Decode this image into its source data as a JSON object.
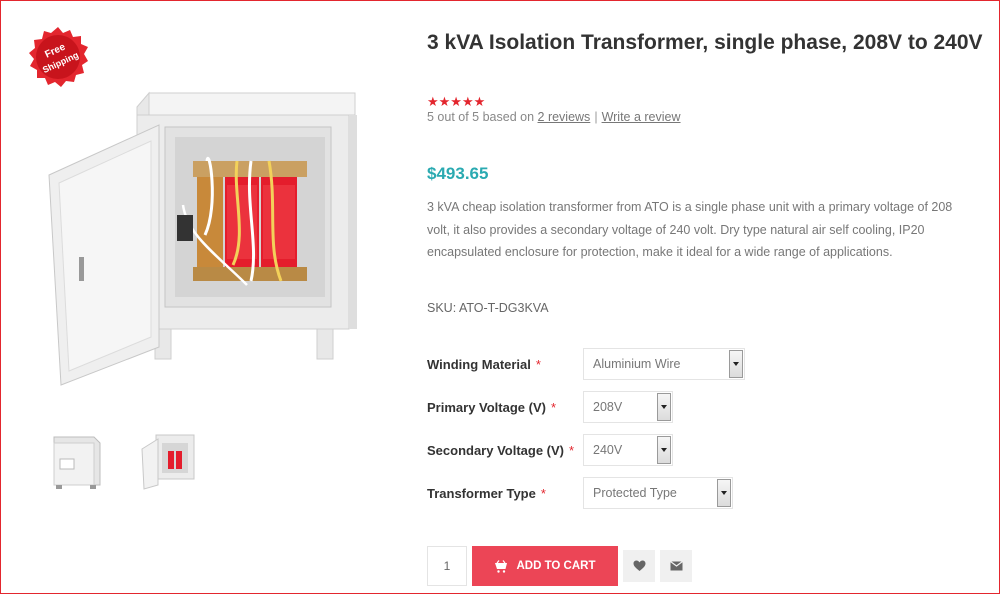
{
  "badge": {
    "line1": "Free",
    "line2": "Shipping"
  },
  "product": {
    "title": "3 kVA Isolation Transformer, single phase, 208V to 240V",
    "stars": "★★★★★",
    "rating_value": 5,
    "rating_prefix": "5 out of 5 based on",
    "reviews_link": "2 reviews",
    "separator": "|",
    "write_review": "Write a review",
    "price": "$493.65",
    "description_lines": [
      "3 kVA cheap isolation transformer from ATO is a single phase unit with a primary voltage of 208",
      "volt, it also provides a secondary voltage of 240 volt. Dry type natural air self cooling, IP20",
      "encapsulated enclosure for protection, make it ideal for a wide range of applications."
    ],
    "sku": "SKU: ATO-T-DG3KVA"
  },
  "options": [
    {
      "label": "Winding Material",
      "required": "*",
      "value": "Aluminium Wire"
    },
    {
      "label": "Primary Voltage (V)",
      "required": "*",
      "value": "208V"
    },
    {
      "label": "Secondary Voltage (V)",
      "required": "*",
      "value": "240V"
    },
    {
      "label": "Transformer Type",
      "required": "*",
      "value": "Protected Type"
    }
  ],
  "cart": {
    "quantity": "1",
    "add_label": "ADD TO CART"
  },
  "icons": {
    "badge": "free-shipping-badge-icon",
    "cart": "cart-icon",
    "wishlist": "heart-icon",
    "share": "envelope-icon"
  },
  "colors": {
    "accent_red": "#ec4556",
    "price_teal": "#2aaab1",
    "star_red": "#e3262e",
    "frame_red": "#e3262e"
  }
}
